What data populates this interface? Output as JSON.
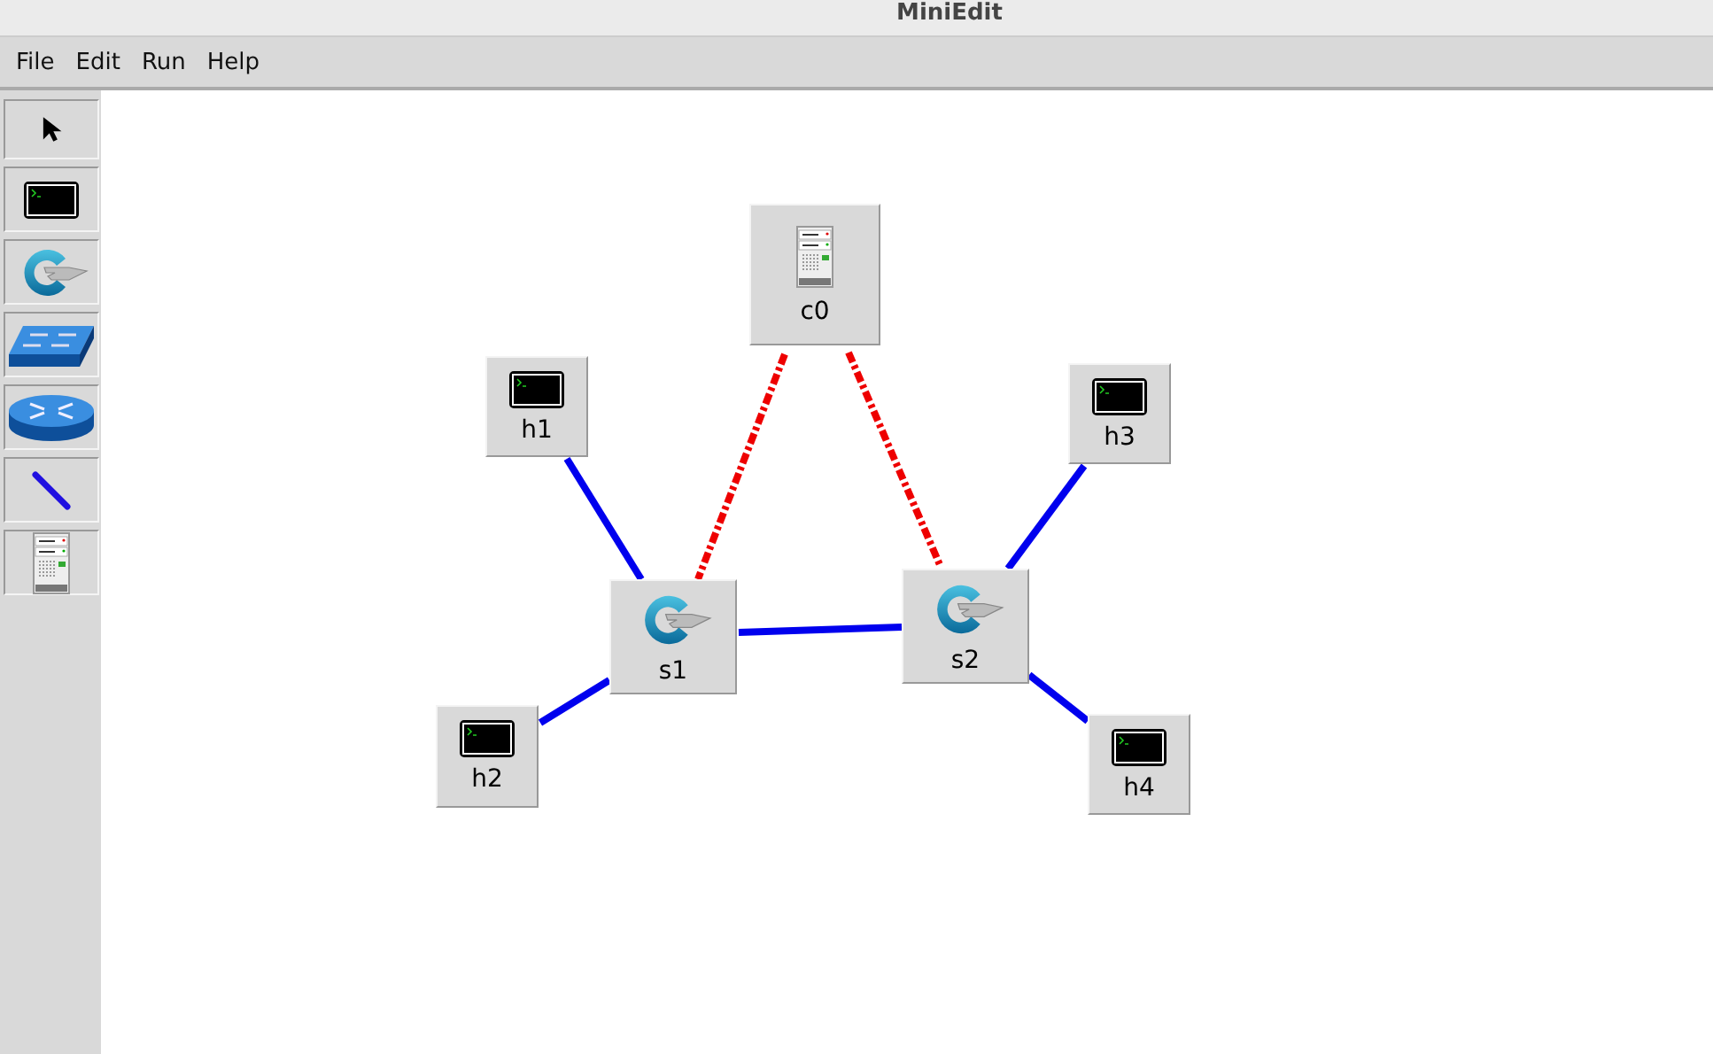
{
  "window": {
    "title": "MiniEdit"
  },
  "menu": [
    "File",
    "Edit",
    "Run",
    "Help"
  ],
  "tools": [
    {
      "kind": "select"
    },
    {
      "kind": "host"
    },
    {
      "kind": "switch"
    },
    {
      "kind": "legacy_switch"
    },
    {
      "kind": "router"
    },
    {
      "kind": "link"
    },
    {
      "kind": "controller"
    }
  ],
  "nodes": [
    {
      "label": "c0",
      "kind": "controller"
    },
    {
      "label": "h1",
      "kind": "host"
    },
    {
      "label": "h3",
      "kind": "host"
    },
    {
      "label": "s1",
      "kind": "switch"
    },
    {
      "label": "s2",
      "kind": "switch"
    },
    {
      "label": "h2",
      "kind": "host"
    },
    {
      "label": "h4",
      "kind": "host"
    }
  ],
  "links": [
    {
      "kind": "data"
    },
    {
      "kind": "data"
    },
    {
      "kind": "data"
    },
    {
      "kind": "data"
    },
    {
      "kind": "data"
    },
    {
      "kind": "control"
    },
    {
      "kind": "control"
    }
  ]
}
